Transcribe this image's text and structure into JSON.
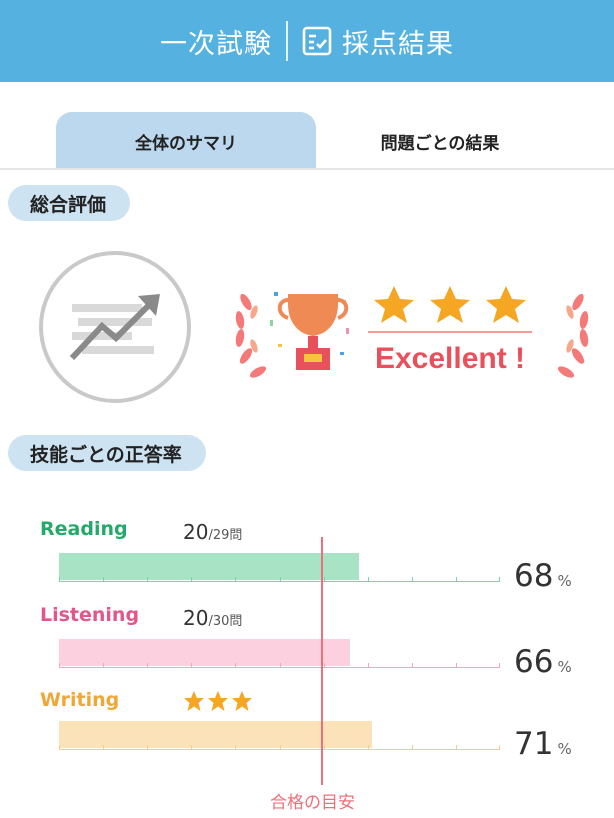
{
  "header": {
    "exam": "一次試験",
    "title": "採点結果"
  },
  "tabs": [
    {
      "label": "全体のサマリ",
      "active": true
    },
    {
      "label": "問題ごとの結果",
      "active": false
    }
  ],
  "overall": {
    "heading": "総合評価",
    "badge_text": "Excellent !",
    "badge_stars": 3
  },
  "skills": {
    "heading": "技能ごとの正答率",
    "pass_label": "合格の目安",
    "items": [
      {
        "name": "Reading",
        "color": "#25a96b",
        "bar_color": "#a8e3c5",
        "line_color": "#7fd1a8",
        "count": "20",
        "total": "/29問",
        "rate": 68,
        "pct_text": "68",
        "unit": "%"
      },
      {
        "name": "Listening",
        "color": "#e2568c",
        "bar_color": "#fcd0df",
        "line_color": "#f4a6c1",
        "count": "20",
        "total": "/30問",
        "rate": 66,
        "pct_text": "66",
        "unit": "%"
      },
      {
        "name": "Writing",
        "color": "#f0a736",
        "bar_color": "#fce2b8",
        "line_color": "#f5cd8f",
        "stars": 3,
        "rate": 71,
        "pct_text": "71",
        "unit": "%"
      }
    ]
  },
  "colors": {
    "header_bg": "#55b2e0",
    "active_tab": "#bcd8ee",
    "pill_bg": "#cde3f2",
    "pass_line": "#f0707a",
    "star": "#f5a623"
  }
}
